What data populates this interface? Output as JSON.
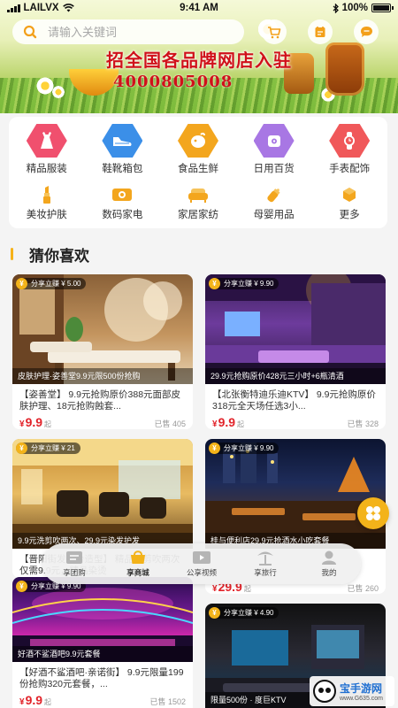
{
  "status_bar": {
    "carrier": "LAILVX",
    "time": "9:41 AM",
    "battery": "100%"
  },
  "search": {
    "placeholder": "请输入关键词"
  },
  "banner": {
    "slogan": "招全国各品牌网店入驻",
    "phone": "4000805008"
  },
  "categories_row1": [
    {
      "label": "精品服装",
      "icon": "dress-icon",
      "color": "#f0506e"
    },
    {
      "label": "鞋靴箱包",
      "icon": "shoe-icon",
      "color": "#3b8fe8"
    },
    {
      "label": "食品生鲜",
      "icon": "food-icon",
      "color": "#f3a61e"
    },
    {
      "label": "日用百货",
      "icon": "tissue-icon",
      "color": "#a877e4"
    },
    {
      "label": "手表配饰",
      "icon": "watch-icon",
      "color": "#f0585a"
    }
  ],
  "categories_row2": [
    {
      "label": "美妆护肤",
      "icon": "lipstick-icon"
    },
    {
      "label": "数码家电",
      "icon": "appliance-icon"
    },
    {
      "label": "家居家纺",
      "icon": "sofa-icon"
    },
    {
      "label": "母婴用品",
      "icon": "baby-bottle-icon"
    },
    {
      "label": "更多",
      "icon": "more-icon"
    }
  ],
  "section": {
    "title": "猜你喜欢"
  },
  "products": [
    {
      "share": "分享立赚 ¥ 5.00",
      "caption": "皮肤护理·姿善堂9.9元限500份抢购",
      "title": "【姿善堂】 9.9元抢购原价388元面部皮肤护理、18元抢购蝕套...",
      "price": "9.9",
      "price_suffix": "起",
      "sold": "已售 405"
    },
    {
      "share": "分享立赚 ¥ 9.90",
      "caption": "29.9元抢购原价428元三小时+6瓶清酒",
      "title": "【北张衡特迪乐迪KTV】 9.9元抢购原价318元全天场任选3小...",
      "price": "9.9",
      "price_suffix": "起",
      "sold": "已售 328"
    },
    {
      "share": "分享立赚 ¥ 21",
      "caption": "9.9元洗剪吹两次、29.9元染发护发",
      "title": "【晋阳街发舞台造型】 精品洗剪吹两次仅需9.9元，精品染烫",
      "price": "",
      "price_suffix": "",
      "sold": ""
    },
    {
      "share": "分享立赚 ¥ 9.90",
      "caption": "桂与便利店29.9元抢酒水小吃套餐",
      "title": "",
      "price": "29.9",
      "price_suffix": "起",
      "sold": "已售 260"
    },
    {
      "share": "分享立赚 ¥ 9.90",
      "caption": "好酒不鲨酒吧9.9元套餐",
      "title": "【好酒不鲨酒吧·亲诺街】 9.9元限量199份抢购320元套餐，...",
      "price": "9.9",
      "price_suffix": "起",
      "sold": "已售 1502"
    },
    {
      "share": "分享立赚 ¥ 4.90",
      "caption": "限量500份 · 度巨KTV",
      "title": "",
      "price": "",
      "price_suffix": "",
      "sold": ""
    }
  ],
  "nav": [
    {
      "label": "享团购",
      "icon": "group-buy-icon",
      "active": false
    },
    {
      "label": "享商城",
      "icon": "mall-icon",
      "active": true
    },
    {
      "label": "公享视频",
      "icon": "video-icon",
      "active": false
    },
    {
      "label": "享旅行",
      "icon": "travel-icon",
      "active": false
    },
    {
      "label": "我的",
      "icon": "profile-icon",
      "active": false
    }
  ],
  "watermark": {
    "name": "宝手游网",
    "url": "www.G635.com"
  },
  "colors": {
    "accent": "#f3b31a",
    "price": "#e2232a",
    "banner_text": "#d0101a"
  }
}
